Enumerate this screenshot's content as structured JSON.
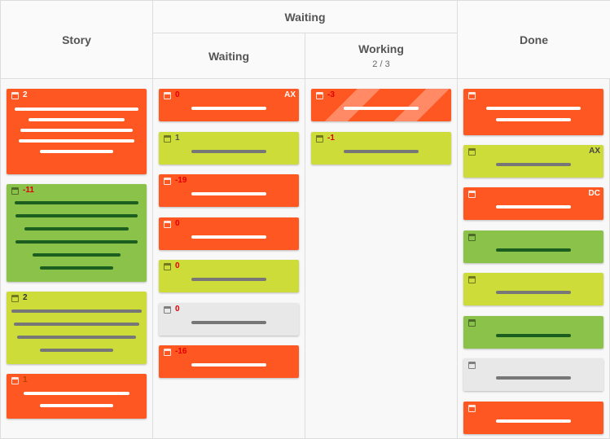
{
  "headers": {
    "story": "Story",
    "waiting_group": "Waiting",
    "waiting": "Waiting",
    "working": "Working",
    "working_count": "2 / 3",
    "done": "Done"
  },
  "story_cards": [
    {
      "number": "2",
      "color": "orange"
    },
    {
      "number": "-11",
      "color": "green"
    },
    {
      "number": "2",
      "color": "lime"
    },
    {
      "number": "1",
      "color": "orange"
    }
  ],
  "waiting_cards": [
    {
      "number": "0",
      "tag": "AX",
      "color": "orange"
    },
    {
      "number": "1",
      "color": "lime"
    },
    {
      "number": "-19",
      "color": "orange"
    },
    {
      "number": "0",
      "color": "orange"
    },
    {
      "number": "0",
      "color": "lime"
    },
    {
      "number": "0",
      "color": "grey"
    },
    {
      "number": "-16",
      "color": "orange"
    }
  ],
  "working_cards": [
    {
      "number": "-3",
      "color": "orange-striped"
    },
    {
      "number": "-1",
      "color": "lime"
    }
  ],
  "done_cards": [
    {
      "color": "orange"
    },
    {
      "tag": "AX",
      "color": "lime"
    },
    {
      "tag": "DC",
      "color": "orange"
    },
    {
      "color": "green"
    },
    {
      "color": "lime"
    },
    {
      "color": "green"
    },
    {
      "color": "grey"
    },
    {
      "color": "orange"
    }
  ],
  "icons": {
    "card_due": "calendar-icon"
  },
  "colors": {
    "orange": "#ff5722",
    "lime": "#cddc39",
    "green": "#8bc34a",
    "grey": "#e8e8e8",
    "alert_red": "#e00000"
  }
}
